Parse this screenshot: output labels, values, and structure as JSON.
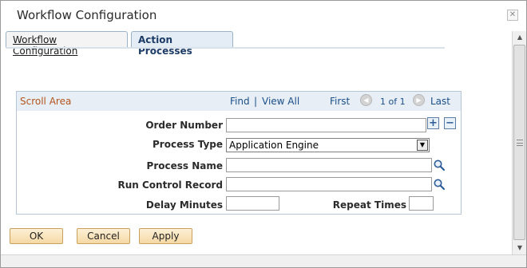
{
  "dialog": {
    "title": "Workflow Configuration",
    "close_glyph": "✕"
  },
  "tabs": [
    {
      "label": "Workflow Configuration",
      "active": false
    },
    {
      "label": "Action Processes",
      "active": true
    }
  ],
  "scroll_area": {
    "title": "Scroll Area",
    "find": "Find",
    "separator": "|",
    "view_all": "View All",
    "first": "First",
    "count": "1 of 1",
    "last": "Last"
  },
  "form": {
    "order_number": {
      "label": "Order Number",
      "value": ""
    },
    "process_type": {
      "label": "Process Type",
      "value": "Application Engine"
    },
    "process_name": {
      "label": "Process Name",
      "value": ""
    },
    "run_control_record": {
      "label": "Run Control Record",
      "value": ""
    },
    "delay_minutes": {
      "label": "Delay Minutes",
      "value": ""
    },
    "repeat_times": {
      "label": "Repeat Times",
      "value": ""
    }
  },
  "buttons": {
    "ok": "OK",
    "cancel": "Cancel",
    "apply": "Apply"
  },
  "icons": {
    "add_row": "+",
    "delete_row": "−",
    "lookup": "magnifier-icon",
    "prev": "◀",
    "next": "▶",
    "dropdown": "▼"
  },
  "colors": {
    "group_title": "#b3541e",
    "link": "#1b4f8a",
    "button_border": "#c9a15e"
  }
}
